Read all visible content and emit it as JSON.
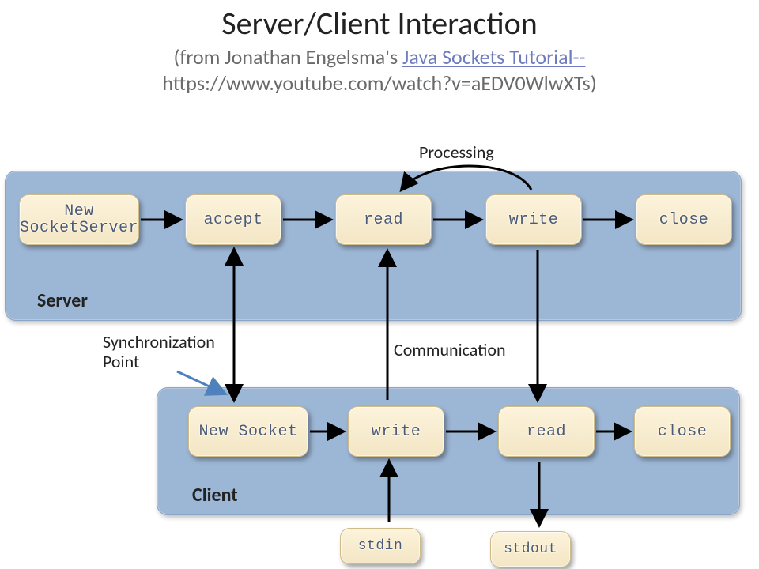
{
  "title": "Server/Client Interaction",
  "subtitle_prefix": "(from Jonathan Engelsma's ",
  "subtitle_link": "Java Sockets Tutorial--",
  "subtitle_url_text": "https://www.youtube.com/watch?v=aEDV0WlwXTs)",
  "panels": {
    "server": {
      "label": "Server"
    },
    "client": {
      "label": "Client"
    }
  },
  "server_nodes": {
    "new_socketserver": "New\nSocketServer",
    "accept": "accept",
    "read": "read",
    "write": "write",
    "close": "close"
  },
  "client_nodes": {
    "new_socket": "New Socket",
    "write": "write",
    "read": "read",
    "close": "close"
  },
  "io_nodes": {
    "stdin": "stdin",
    "stdout": "stdout"
  },
  "annotations": {
    "processing": "Processing",
    "sync_point": "Synchronization\nPoint",
    "communication": "Communication"
  }
}
